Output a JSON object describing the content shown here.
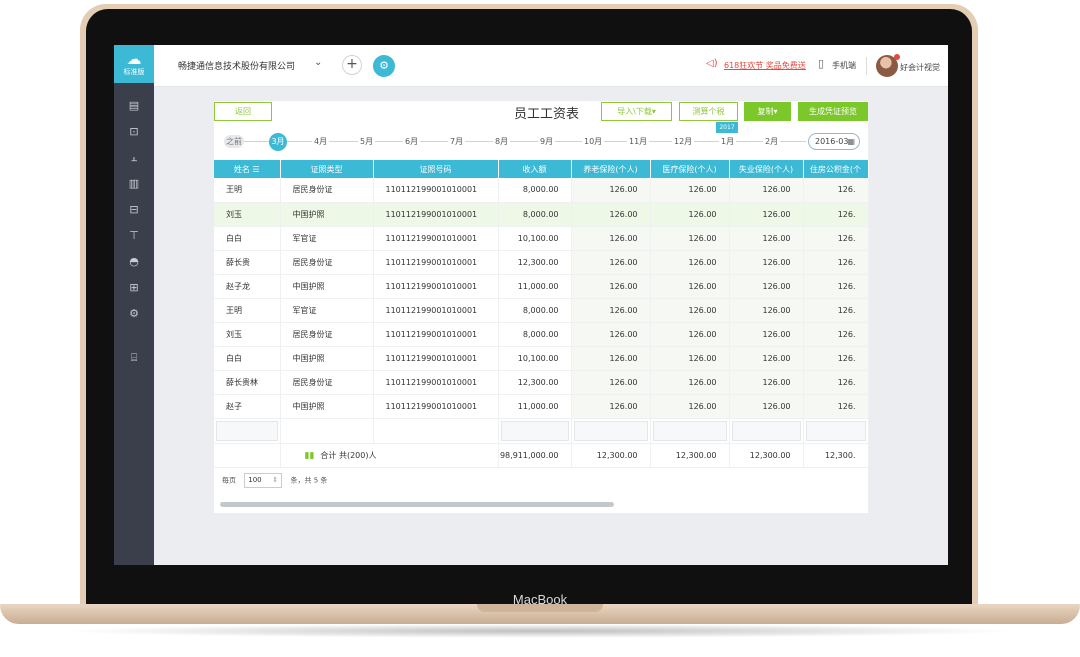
{
  "device": {
    "brand": "MacBook"
  },
  "sidebar": {
    "logo_label": "标准版",
    "logo_glyph": "☁",
    "icons": [
      "▤",
      "⊡",
      "⫠",
      "▥",
      "⊟",
      "⊤",
      "◓",
      "⊞",
      "⚙",
      "⌸"
    ]
  },
  "topbar": {
    "company": "畅捷通信息技术股份有限公司",
    "caret": "⌄",
    "plus": "+",
    "gear": "⚙",
    "promo_icon": "◁)",
    "promo": "618狂欢节 奖品免费送",
    "mobile_icon": "▯",
    "mobile": "手机端",
    "username": "好会计视觉"
  },
  "toolbar": {
    "back": "返回",
    "title": "员工工资表",
    "import": "导入\\下载▾",
    "calc": "测算个税",
    "copy": "复制▾",
    "generate": "生成凭证预览"
  },
  "timeline": {
    "before": "之前",
    "active": "3月",
    "months": [
      "4月",
      "5月",
      "6月",
      "7月",
      "8月",
      "9月",
      "10月",
      "11月",
      "12月",
      "1月",
      "2月"
    ],
    "year_tag": "2017",
    "date": "2016-03",
    "cal_icon": "▦"
  },
  "table": {
    "headers": [
      "姓名 ☰",
      "证照类型",
      "证照号码",
      "收入额",
      "养老保险(个人)",
      "医疗保险(个人)",
      "失业保险(个人)",
      "住房公积金(个"
    ],
    "rows": [
      [
        "王明",
        "居民身份证",
        "110112199001010001",
        "8,000.00",
        "126.00",
        "126.00",
        "126.00",
        "126."
      ],
      [
        "刘玉",
        "中国护照",
        "110112199001010001",
        "8,000.00",
        "126.00",
        "126.00",
        "126.00",
        "126."
      ],
      [
        "白白",
        "军官证",
        "110112199001010001",
        "10,100.00",
        "126.00",
        "126.00",
        "126.00",
        "126."
      ],
      [
        "薛长贵",
        "居民身份证",
        "110112199001010001",
        "12,300.00",
        "126.00",
        "126.00",
        "126.00",
        "126."
      ],
      [
        "赵子龙",
        "中国护照",
        "110112199001010001",
        "11,000.00",
        "126.00",
        "126.00",
        "126.00",
        "126."
      ],
      [
        "王明",
        "军官证",
        "110112199001010001",
        "8,000.00",
        "126.00",
        "126.00",
        "126.00",
        "126."
      ],
      [
        "刘玉",
        "居民身份证",
        "110112199001010001",
        "8,000.00",
        "126.00",
        "126.00",
        "126.00",
        "126."
      ],
      [
        "白白",
        "中国护照",
        "110112199001010001",
        "10,100.00",
        "126.00",
        "126.00",
        "126.00",
        "126."
      ],
      [
        "薛长贵林",
        "居民身份证",
        "110112199001010001",
        "12,300.00",
        "126.00",
        "126.00",
        "126.00",
        "126."
      ],
      [
        "赵子",
        "中国护照",
        "110112199001010001",
        "11,000.00",
        "126.00",
        "126.00",
        "126.00",
        "126."
      ]
    ],
    "summary": {
      "icon": "▮▮",
      "label": "合计  共(200)人",
      "income": "98,911,000.00",
      "pension": "12,300.00",
      "medical": "12,300.00",
      "unemployment": "12,300.00",
      "housing": "12,300."
    }
  },
  "pager": {
    "prefix": "每页",
    "size": "100",
    "spinner": "⇕",
    "suffix": "条，共 5 条"
  }
}
